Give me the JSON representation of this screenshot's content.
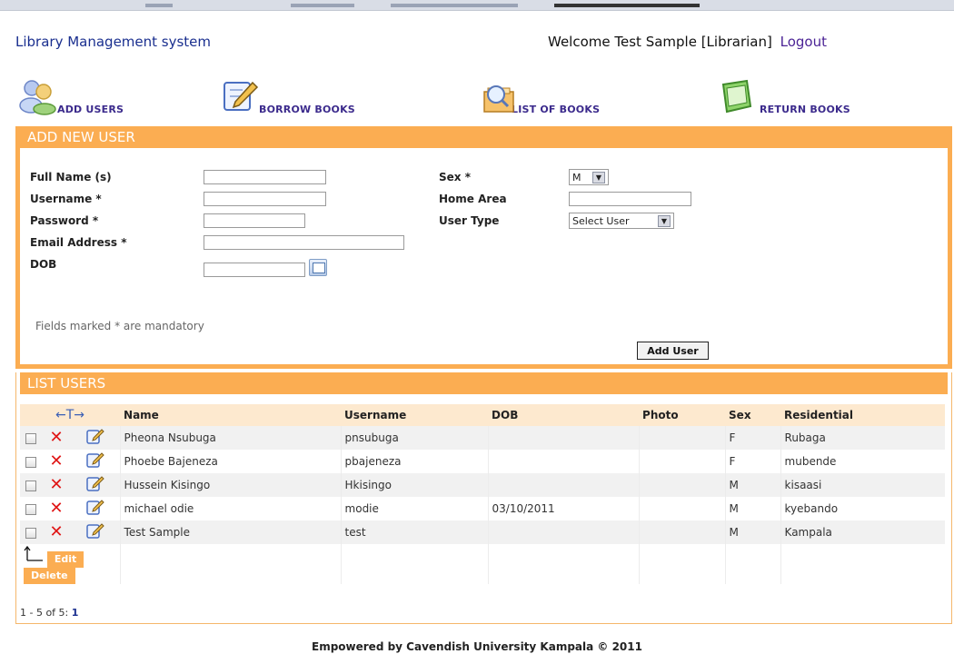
{
  "header": {
    "brand": "Library Management system",
    "welcome": "Welcome  Test Sample [Librarian]",
    "logout": "Logout"
  },
  "nav": [
    {
      "label": "ADD USERS",
      "icon": "users-icon"
    },
    {
      "label": "BORROW BOOKS",
      "icon": "pencil-edit-icon"
    },
    {
      "label": "LIST OF BOOKS",
      "icon": "magnifier-book-icon"
    },
    {
      "label": "RETURN BOOKS",
      "icon": "green-book-icon"
    }
  ],
  "add_user": {
    "title": "ADD NEW USER",
    "fields": {
      "fullname": "Full Name (s)",
      "username": "Username *",
      "password": "Password *",
      "email": "Email Address *",
      "dob": "DOB",
      "sex": "Sex *",
      "home_area": "Home Area",
      "user_type": "User Type"
    },
    "sex_value": "M",
    "user_type_value": "Select User",
    "note": "Fields marked * are mandatory",
    "submit": "Add User"
  },
  "list": {
    "title": "LIST USERS",
    "sort_glyph": "←T→",
    "columns": [
      "Name",
      "Username",
      "DOB",
      "Photo",
      "Sex",
      "Residential"
    ],
    "rows": [
      {
        "name": "Pheona Nsubuga",
        "username": "pnsubuga",
        "dob": "",
        "photo": "",
        "sex": "F",
        "residential": "Rubaga"
      },
      {
        "name": "Phoebe Bajeneza",
        "username": "pbajeneza",
        "dob": "",
        "photo": "",
        "sex": "F",
        "residential": "mubende"
      },
      {
        "name": "Hussein Kisingo",
        "username": "Hkisingo",
        "dob": "",
        "photo": "",
        "sex": "M",
        "residential": "kisaasi"
      },
      {
        "name": "michael odie",
        "username": "modie",
        "dob": "03/10/2011",
        "photo": "",
        "sex": "M",
        "residential": "kyebando"
      },
      {
        "name": "Test Sample",
        "username": "test",
        "dob": "",
        "photo": "",
        "sex": "M",
        "residential": "Kampala"
      }
    ],
    "edit_label": "Edit",
    "delete_label": "Delete",
    "pager_text": "1 - 5 of 5: ",
    "pager_page": "1"
  },
  "footer": "Empowered by Cavendish University Kampala © 2011",
  "colors": {
    "accent": "#fbad52",
    "brand": "#1a2f8f",
    "nav": "#3b2a8c"
  }
}
